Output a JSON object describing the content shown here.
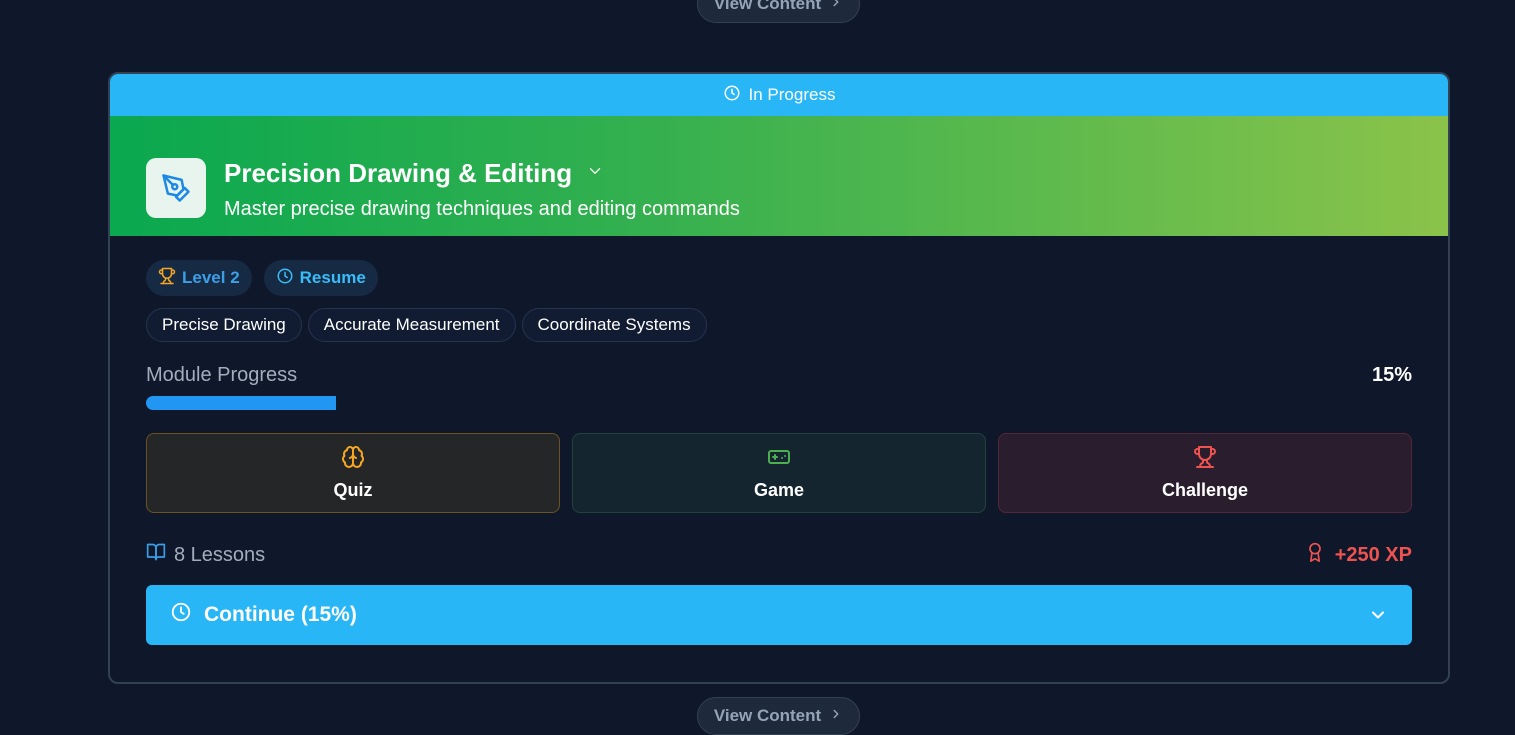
{
  "view_content_top": {
    "label": "View Content",
    "icon": "chevron-right-icon"
  },
  "view_content_bottom": {
    "label": "View Content",
    "icon": "chevron-right-icon"
  },
  "module": {
    "status": {
      "label": "In Progress",
      "icon": "clock-icon",
      "color": "#29b6f6"
    },
    "icon": "pen-tool-icon",
    "title": "Precision Drawing & Editing",
    "subtitle": "Master precise drawing techniques and editing commands",
    "gradient": [
      "#0aa84f",
      "#8bc34a"
    ],
    "badges": [
      {
        "label": "Level 2",
        "icon": "trophy-icon"
      },
      {
        "label": "Resume",
        "icon": "clock-icon"
      }
    ],
    "tags": [
      "Precise Drawing",
      "Accurate Measurement",
      "Coordinate Systems"
    ],
    "progress": {
      "label": "Module Progress",
      "value_text": "15%",
      "fraction": 0.15,
      "color": "#2196f3"
    },
    "activities": [
      {
        "label": "Quiz",
        "icon": "brain-icon",
        "color": "#f5a623"
      },
      {
        "label": "Game",
        "icon": "gamepad-icon",
        "color": "#4caf50"
      },
      {
        "label": "Challenge",
        "icon": "trophy-icon",
        "color": "#ef5350"
      }
    ],
    "lessons": {
      "label": "8 Lessons",
      "icon": "book-open-icon"
    },
    "xp": {
      "label": "+250 XP",
      "icon": "award-icon",
      "color": "#ef5350"
    },
    "continue_button": {
      "label": "Continue (15%)",
      "icon": "clock-icon",
      "chevron": "chevron-down-icon"
    }
  }
}
